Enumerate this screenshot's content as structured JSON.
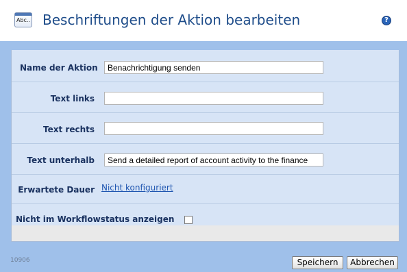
{
  "header": {
    "app_icon_text": "Abc..",
    "title": "Beschriftungen der Aktion bearbeiten",
    "help_glyph": "?"
  },
  "form": {
    "name_label": "Name der Aktion",
    "name_value": "Benachrichtigung senden",
    "text_left_label": "Text links",
    "text_left_value": "",
    "text_right_label": "Text rechts",
    "text_right_value": "",
    "text_below_label": "Text unterhalb",
    "text_below_value": "Send a detailed report of account activity to the finance",
    "duration_label": "Erwartete Dauer",
    "duration_link": "Nicht konfiguriert",
    "hide_status_label": "Nicht im Workflowstatus anzeigen",
    "hide_status_checked": false
  },
  "footer": {
    "code": "10906",
    "save_label": "Speichern",
    "cancel_label": "Abbrechen"
  },
  "colors": {
    "title": "#1f4d8a",
    "label": "#1a3260",
    "link": "#1e55b0",
    "panel_bg": "#d7e4f6",
    "frame_bg": "#9fc0ea"
  }
}
